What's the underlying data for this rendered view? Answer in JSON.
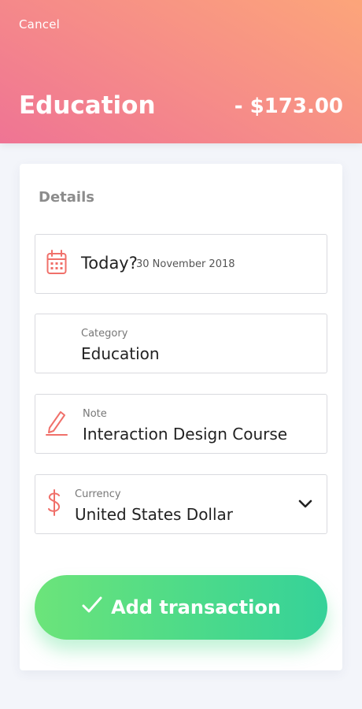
{
  "header": {
    "cancel_label": "Cancel",
    "title": "Education",
    "amount": "- $173.00"
  },
  "details": {
    "section_label": "Details",
    "date": {
      "main": "Today?",
      "sub": "30 November 2018",
      "icon": "calendar-icon"
    },
    "category": {
      "label": "Category",
      "value": "Education"
    },
    "note": {
      "label": "Note",
      "value": "Interaction Design Course",
      "icon": "pencil-icon"
    },
    "currency": {
      "label": "Currency",
      "value": "United States Dollar",
      "icon": "dollar-icon"
    }
  },
  "action": {
    "add_label": "Add transaction",
    "icon": "checkmark-icon"
  },
  "colors": {
    "accent": "#f0706a",
    "header_gradient_start": "#ef7494",
    "header_gradient_end": "#fca57a",
    "button_gradient_start": "#6ce47a",
    "button_gradient_end": "#35d299"
  }
}
